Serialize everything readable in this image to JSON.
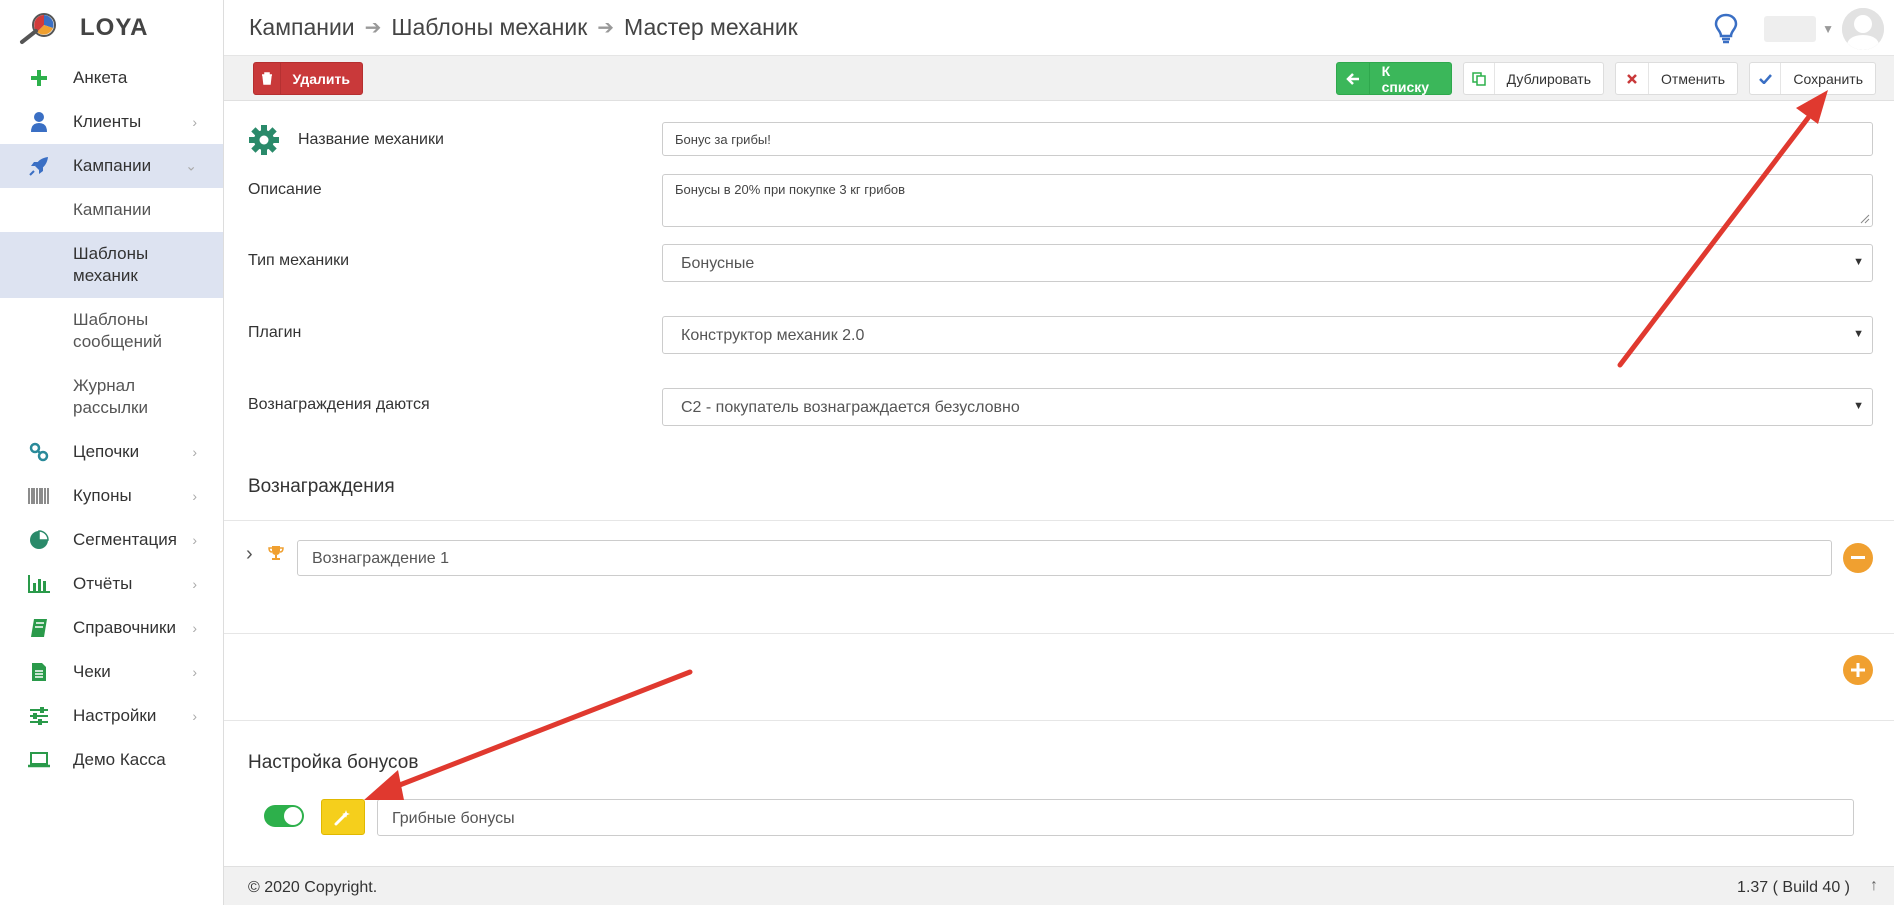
{
  "app": {
    "logo_text": "LOYA"
  },
  "breadcrumb": [
    "Кампании",
    "Шаблоны механик",
    "Мастер механик"
  ],
  "sidebar": {
    "items": [
      {
        "label": "Анкета",
        "icon": "plus-icon",
        "color": "#2db04b"
      },
      {
        "label": "Клиенты",
        "icon": "user-icon",
        "color": "#3a6fc4"
      },
      {
        "label": "Кампании",
        "icon": "rocket-icon",
        "color": "#3a6fc4"
      },
      {
        "label": "Цепочки",
        "icon": "link-icon",
        "color": "#2a8a9a"
      },
      {
        "label": "Купоны",
        "icon": "barcode-icon",
        "color": "#666"
      },
      {
        "label": "Сегментация",
        "icon": "pie-chart-icon",
        "color": "#2a8a6a"
      },
      {
        "label": "Отчёты",
        "icon": "bar-chart-icon",
        "color": "#2a9a4a"
      },
      {
        "label": "Справочники",
        "icon": "book-icon",
        "color": "#2a9a4a"
      },
      {
        "label": "Чеки",
        "icon": "document-icon",
        "color": "#2a9a4a"
      },
      {
        "label": "Настройки",
        "icon": "sliders-icon",
        "color": "#2a9a4a"
      },
      {
        "label": "Демо Касса",
        "icon": "laptop-icon",
        "color": "#2a9a4a"
      }
    ],
    "sub_items": [
      "Кампании",
      "Шаблоны механик",
      "Шаблоны сообщений",
      "Журнал рассылки"
    ]
  },
  "toolbar": {
    "delete_label": "Удалить",
    "list_label": "К списку",
    "duplicate_label": "Дублировать",
    "cancel_label": "Отменить",
    "save_label": "Сохранить"
  },
  "form": {
    "name_label": "Название механики",
    "name_value": "Бонус за грибы!",
    "description_label": "Описание",
    "description_value": "Бонусы в 20% при покупке 3 кг грибов",
    "type_label": "Тип механики",
    "type_value": "Бонусные",
    "plugin_label": "Плагин",
    "plugin_value": "Конструктор механик 2.0",
    "rewards_given_label": "Вознаграждения даются",
    "rewards_given_value": "C2 - покупатель вознаграждается безусловно"
  },
  "rewards": {
    "title": "Вознаграждения",
    "items": [
      "Вознаграждение 1"
    ]
  },
  "bonus_settings": {
    "title": "Настройка бонусов",
    "name_value": "Грибные бонусы",
    "enabled": true
  },
  "footer": {
    "copyright": "© 2020 Copyright.",
    "version": "1.37 ( Build 40 )"
  },
  "colors": {
    "accent": "#3bb75a",
    "danger": "#c9393a",
    "highlight": "#f5cf1c",
    "annotation_arrow": "#e0392f"
  }
}
